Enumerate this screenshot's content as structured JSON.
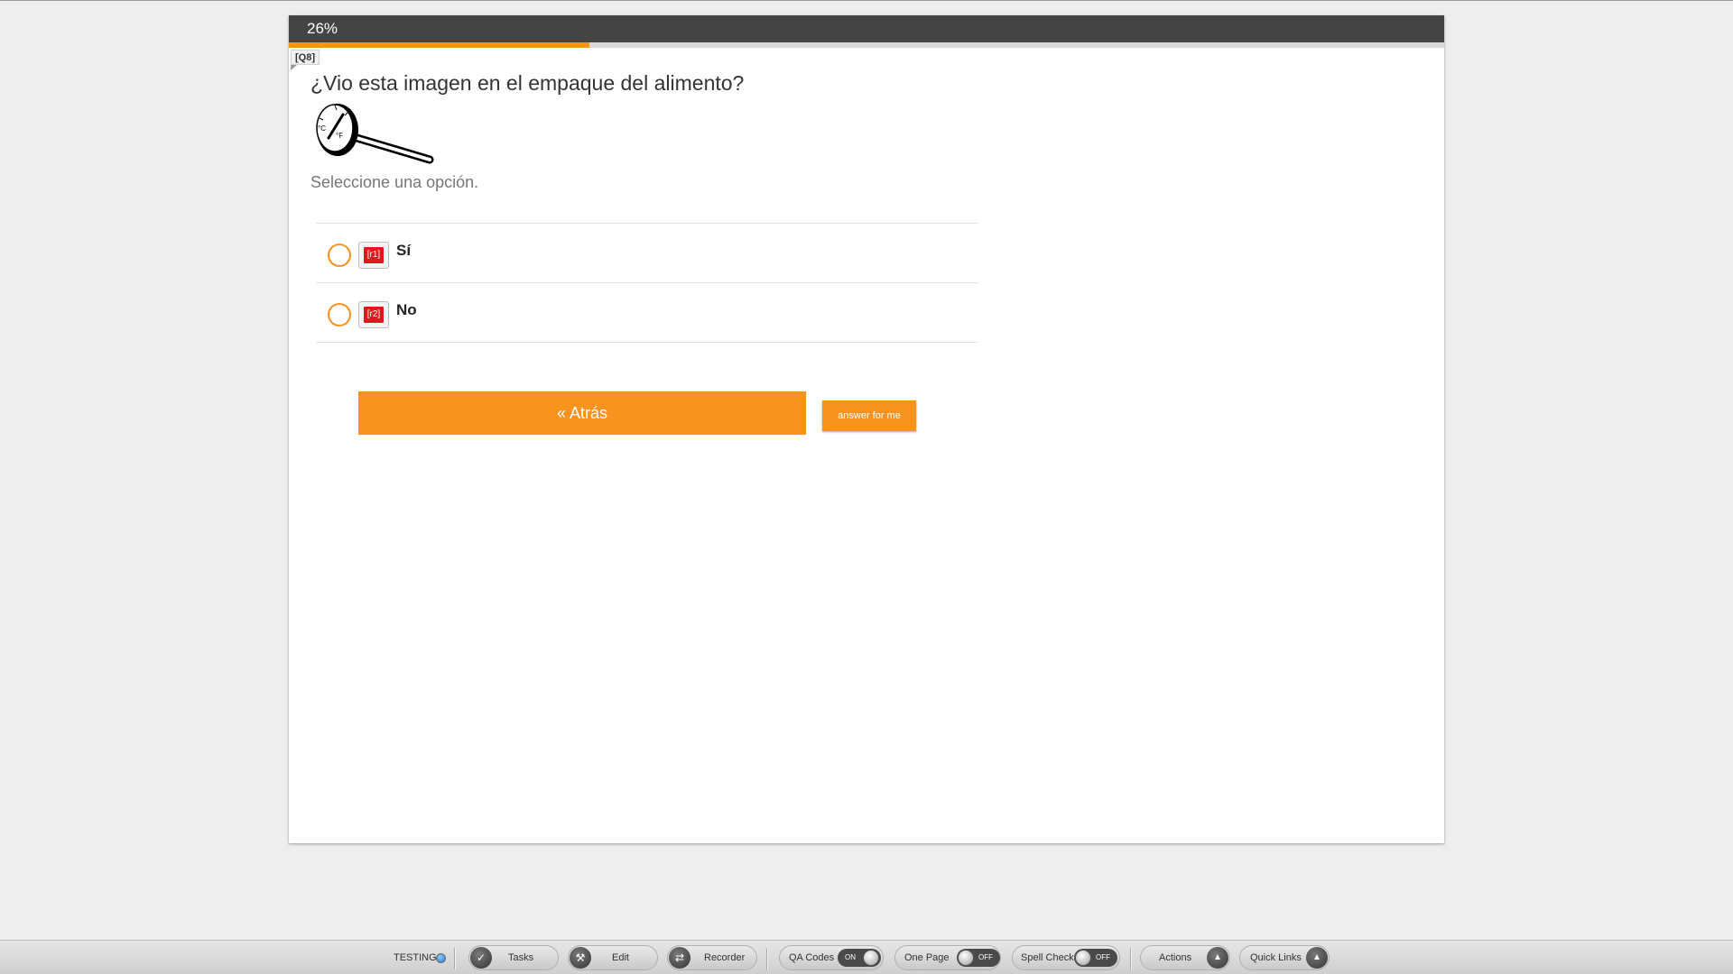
{
  "progress": {
    "label": "26%",
    "value": 0.26
  },
  "question": {
    "id_label": "[Q8]",
    "text": "¿Vio esta imagen en el empaque del alimento?",
    "image_icon": "thermometer-icon",
    "image_marks": {
      "c": "°C",
      "f": "°F"
    },
    "instruction": "Seleccione una opción."
  },
  "answers": [
    {
      "code": "[r1]",
      "label": "Sí"
    },
    {
      "code": "[r2]",
      "label": "No"
    }
  ],
  "buttons": {
    "back": "« Atrás",
    "answer_for_me": "answer for me"
  },
  "toolbar": {
    "testing_label": "TESTING",
    "tasks": "Tasks",
    "edit": "Edit",
    "recorder": "Recorder",
    "qa_codes": {
      "label": "QA Codes",
      "state": "ON"
    },
    "one_page": {
      "label": "One Page",
      "state": "OFF"
    },
    "spell_check": {
      "label": "Spell Check",
      "state": "OFF"
    },
    "actions": "Actions",
    "quick_links": "Quick Links"
  },
  "colors": {
    "accent": "#f7931e",
    "header": "#444444",
    "code_red": "#e0181e"
  }
}
